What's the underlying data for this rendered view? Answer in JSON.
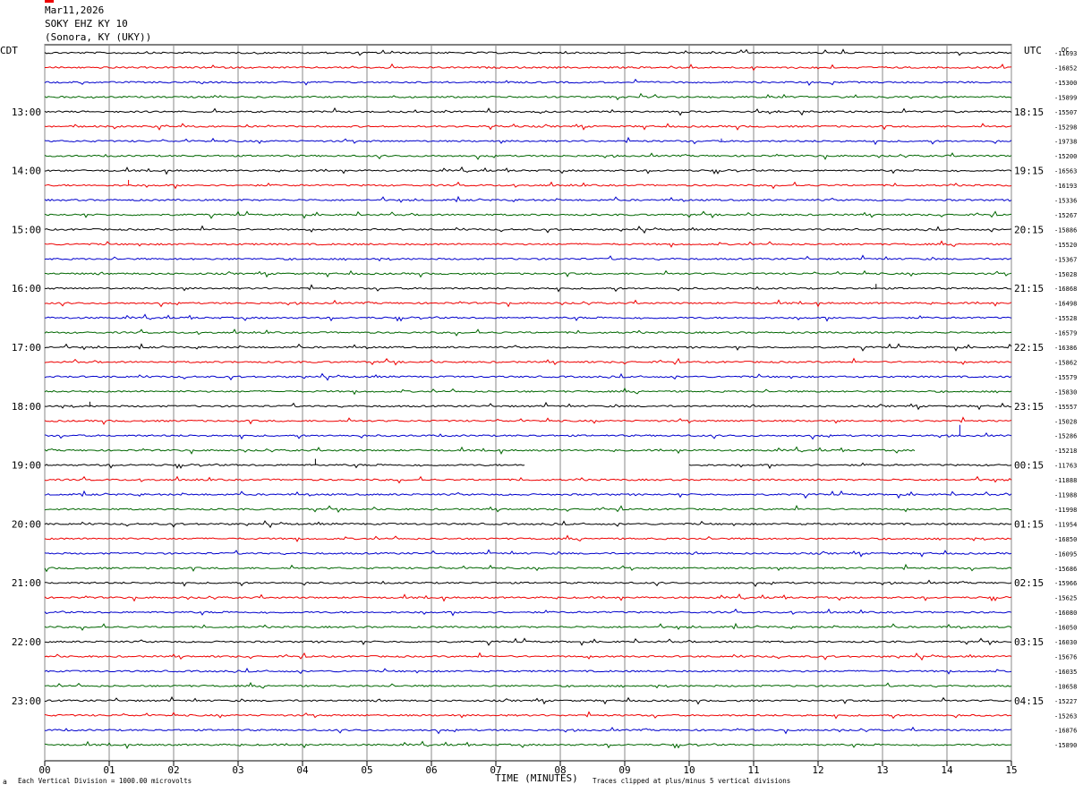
{
  "header": {
    "date": "Mar11,2026",
    "station": "SOKY EHZ KY 10",
    "location": "(Sonora, KY (UKY))"
  },
  "labels": {
    "left_tz": "CDT",
    "right_tz": "UTC",
    "dc": "DC",
    "x_title": "TIME (MINUTES)",
    "scale_note": "Each Vertical Division = 1000.00 microvolts",
    "clip_note": "Traces clipped at plus/minus 5 vertical divisions"
  },
  "colors": {
    "trace_cycle": [
      "#000000",
      "#ee0000",
      "#0000cc",
      "#006600"
    ],
    "grid": "#888888"
  },
  "chart_data": {
    "type": "line",
    "title": "SOKY EHZ KY 10",
    "xlabel": "TIME (MINUTES)",
    "xlim": [
      0,
      15
    ],
    "x_ticks": [
      "00",
      "01",
      "02",
      "03",
      "04",
      "05",
      "06",
      "07",
      "08",
      "09",
      "10",
      "11",
      "12",
      "13",
      "14",
      "15"
    ],
    "rows": 48,
    "row_minutes": 15,
    "left_hour_labels": [
      {
        "row": 4,
        "text": "13:00"
      },
      {
        "row": 8,
        "text": "14:00"
      },
      {
        "row": 12,
        "text": "15:00"
      },
      {
        "row": 16,
        "text": "16:00"
      },
      {
        "row": 20,
        "text": "17:00"
      },
      {
        "row": 24,
        "text": "18:00"
      },
      {
        "row": 28,
        "text": "19:00"
      },
      {
        "row": 32,
        "text": "20:00"
      },
      {
        "row": 36,
        "text": "21:00"
      },
      {
        "row": 40,
        "text": "22:00"
      },
      {
        "row": 44,
        "text": "23:00"
      }
    ],
    "right_hour_labels": [
      {
        "row": 4,
        "text": "18:15"
      },
      {
        "row": 8,
        "text": "19:15"
      },
      {
        "row": 12,
        "text": "20:15"
      },
      {
        "row": 16,
        "text": "21:15"
      },
      {
        "row": 20,
        "text": "22:15"
      },
      {
        "row": 24,
        "text": "23:15"
      },
      {
        "row": 28,
        "text": "00:15"
      },
      {
        "row": 32,
        "text": "01:15"
      },
      {
        "row": 36,
        "text": "02:15"
      },
      {
        "row": 40,
        "text": "03:15"
      },
      {
        "row": 44,
        "text": "04:15"
      }
    ],
    "dc_offsets": [
      "-11693",
      "-16852",
      "-15300",
      "-15899",
      "-15507",
      "-15298",
      "-19738",
      "-15200",
      "-16563",
      "-16193",
      "-15336",
      "-15267",
      "-15886",
      "-15520",
      "-15367",
      "-15028",
      "-16868",
      "-16498",
      "-15528",
      "-16579",
      "-16386",
      "-15862",
      "-15579",
      "-15830",
      "-15557",
      "-15028",
      "-15286",
      "-15218",
      "-11763",
      "-11888",
      "-11988",
      "-11998",
      "-11954",
      "-16850",
      "-16095",
      "-15686",
      "-15966",
      "-15625",
      "-16080",
      "-16050",
      "-16030",
      "-15676",
      "-16035",
      "-10658",
      "-15227",
      "-15263",
      "-16876",
      "-15890"
    ],
    "trace_end_minutes": [
      15,
      15,
      15,
      15,
      15,
      15,
      15,
      15,
      15,
      15,
      15,
      15,
      15,
      15,
      15,
      15,
      15,
      15,
      15,
      15,
      15,
      15,
      15,
      15,
      15,
      15,
      15,
      13.5,
      15,
      15,
      15,
      15,
      15,
      15,
      15,
      15,
      15,
      15,
      15,
      15,
      15,
      15,
      15,
      15,
      15,
      15,
      15,
      15
    ],
    "gap": {
      "row": 28,
      "from_minute": 7.45,
      "to_minute": 10
    }
  }
}
